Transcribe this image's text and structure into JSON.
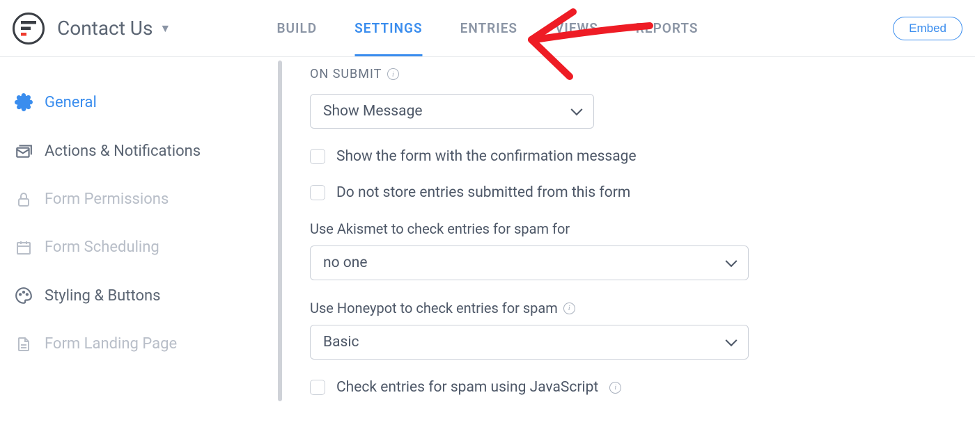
{
  "header": {
    "form_title": "Contact Us",
    "embed_label": "Embed",
    "tabs": [
      {
        "label": "BUILD"
      },
      {
        "label": "SETTINGS",
        "active": true
      },
      {
        "label": "ENTRIES"
      },
      {
        "label": "VIEWS"
      },
      {
        "label": "REPORTS"
      }
    ]
  },
  "sidebar": {
    "items": [
      {
        "label": "General",
        "icon": "gear-icon",
        "active": true
      },
      {
        "label": "Actions & Notifications",
        "icon": "mail-stack-icon"
      },
      {
        "label": "Form Permissions",
        "icon": "lock-icon",
        "disabled": true
      },
      {
        "label": "Form Scheduling",
        "icon": "calendar-icon",
        "disabled": true
      },
      {
        "label": "Styling & Buttons",
        "icon": "palette-icon"
      },
      {
        "label": "Form Landing Page",
        "icon": "page-icon",
        "disabled": true
      }
    ]
  },
  "settings": {
    "section_title": "ON SUBMIT",
    "on_submit_select": "Show Message",
    "show_confirmation_label": "Show the form with the confirmation message",
    "no_store_label": "Do not store entries submitted from this form",
    "akismet_label": "Use Akismet to check entries for spam for",
    "akismet_value": "no one",
    "honeypot_label": "Use Honeypot to check entries for spam",
    "honeypot_value": "Basic",
    "js_spam_label": "Check entries for spam using JavaScript"
  }
}
